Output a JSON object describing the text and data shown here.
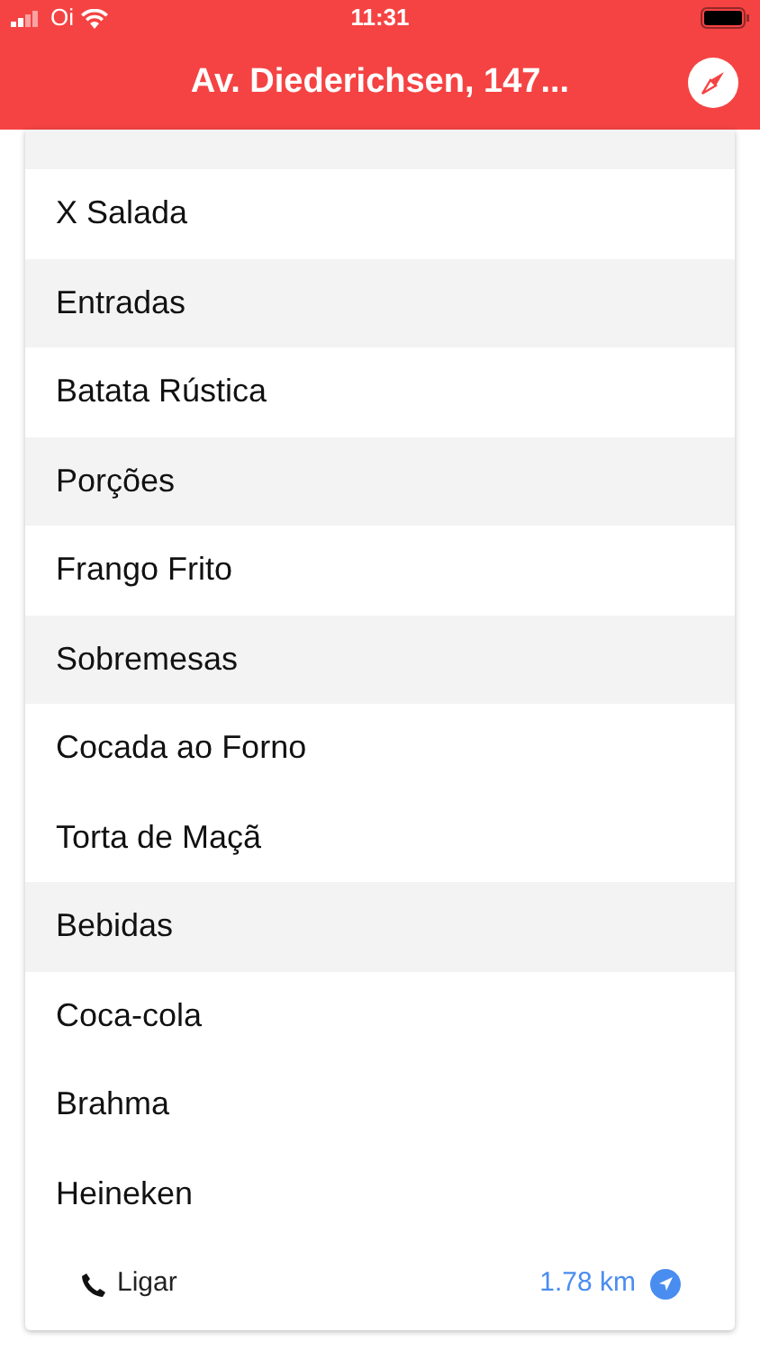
{
  "status_bar": {
    "carrier": "Oi",
    "time": "11:31"
  },
  "nav_bar": {
    "title": "Av. Diederichsen, 147..."
  },
  "menu": [
    {
      "kind": "item",
      "label": "X Salada"
    },
    {
      "kind": "category",
      "label": "Entradas"
    },
    {
      "kind": "item",
      "label": "Batata Rústica"
    },
    {
      "kind": "category",
      "label": "Porções"
    },
    {
      "kind": "item",
      "label": "Frango Frito"
    },
    {
      "kind": "category",
      "label": "Sobremesas"
    },
    {
      "kind": "item",
      "label": "Cocada ao Forno"
    },
    {
      "kind": "item",
      "label": "Torta de Maçã"
    },
    {
      "kind": "category",
      "label": "Bebidas"
    },
    {
      "kind": "item",
      "label": "Coca-cola"
    },
    {
      "kind": "item",
      "label": "Brahma"
    },
    {
      "kind": "item",
      "label": "Heineken"
    }
  ],
  "footer": {
    "call": "Ligar",
    "distance": "1.78 km"
  }
}
